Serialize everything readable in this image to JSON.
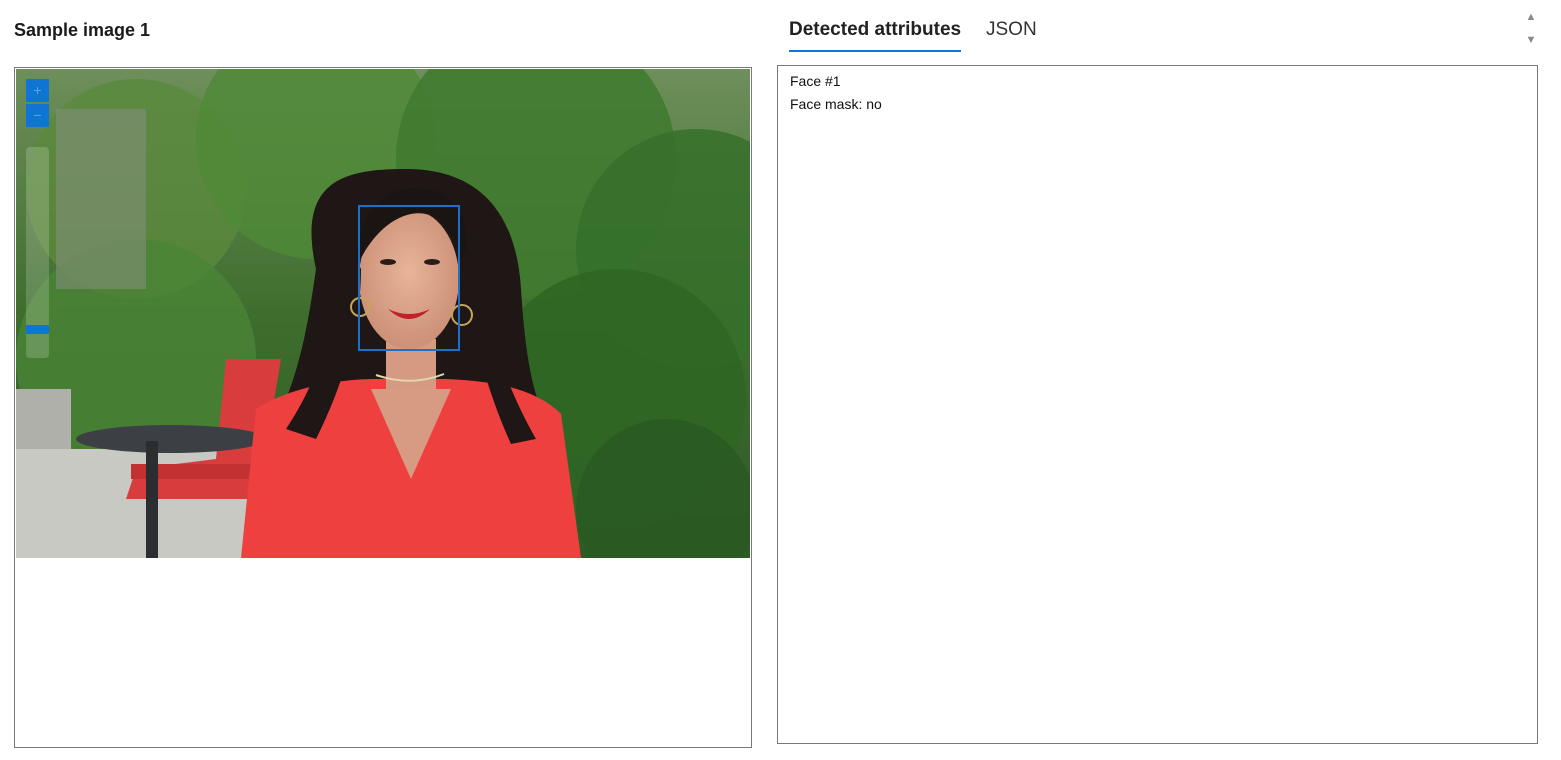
{
  "sample": {
    "title": "Sample image 1"
  },
  "tabs": [
    {
      "label": "Detected attributes",
      "active": true
    },
    {
      "label": "JSON",
      "active": false
    }
  ],
  "zoom": {
    "in_icon": "+",
    "out_icon": "−",
    "level": 0.05
  },
  "attributes": {
    "lines": [
      "Face #1",
      "Face mask: no"
    ]
  },
  "scroll": {
    "up_icon": "▲",
    "down_icon": "▼"
  },
  "colors": {
    "accent": "#1a73d4",
    "face_box": "#1e6fc9"
  }
}
